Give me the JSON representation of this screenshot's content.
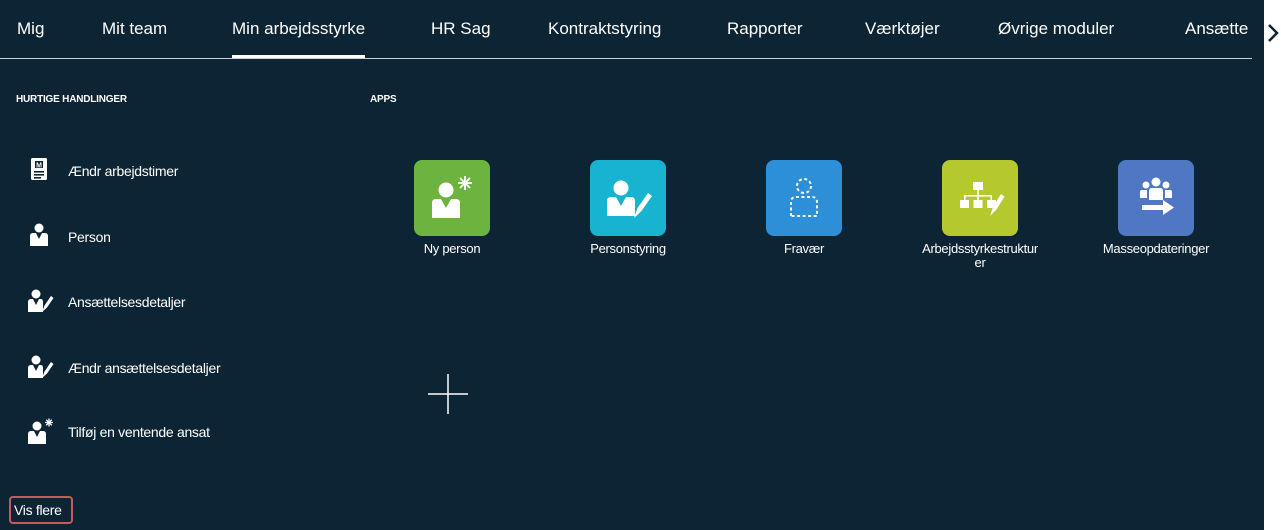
{
  "nav": {
    "tabs": [
      {
        "label": "Mig"
      },
      {
        "label": "Mit team"
      },
      {
        "label": "Min arbejdsstyrke",
        "active": true
      },
      {
        "label": "HR Sag"
      },
      {
        "label": "Kontraktstyring"
      },
      {
        "label": "Rapporter"
      },
      {
        "label": "Værktøjer"
      },
      {
        "label": "Øvrige moduler"
      },
      {
        "label": "Ansætte"
      }
    ],
    "next_icon": "chevron-right-icon"
  },
  "quick_actions": {
    "title": "HURTIGE HANDLINGER",
    "items": [
      {
        "label": "Ændr arbejdstimer",
        "icon": "badge-person-icon"
      },
      {
        "label": "Person",
        "icon": "person-icon"
      },
      {
        "label": "Ansættelsesdetaljer",
        "icon": "person-edit-icon"
      },
      {
        "label": "Ændr ansættelsesdetaljer",
        "icon": "person-edit-icon"
      },
      {
        "label": "Tilføj en ventende ansat",
        "icon": "person-asterisk-icon"
      }
    ],
    "show_more": "Vis flere"
  },
  "apps": {
    "title": "APPS",
    "items": [
      {
        "label": "Ny person",
        "color": "#6cb33f",
        "icon": "new-person-icon"
      },
      {
        "label": "Personstyring",
        "color": "#18b3d1",
        "icon": "person-management-icon"
      },
      {
        "label": "Fravær",
        "color": "#2c8fd8",
        "icon": "absence-icon"
      },
      {
        "label": "Arbejdsstyrkestrukturer",
        "color": "#b5c92e",
        "icon": "workforce-structures-icon"
      },
      {
        "label": "Masseopdateringer",
        "color": "#4f77c4",
        "icon": "mass-updates-icon"
      }
    ],
    "add_icon": "plus-icon"
  },
  "colors": {
    "background": "#0d2434",
    "highlight_border": "#c75b5b"
  }
}
